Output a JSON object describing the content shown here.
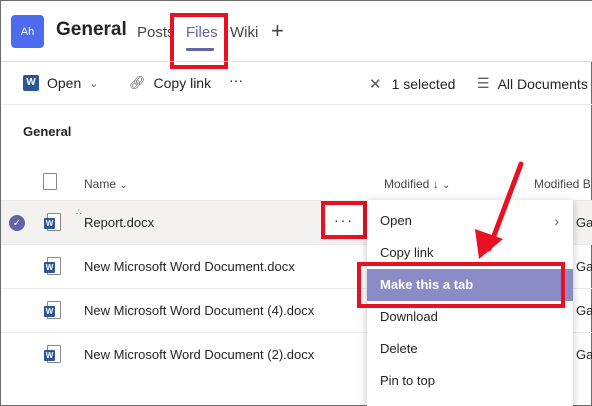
{
  "header": {
    "avatar": "Ah",
    "team_title": "General",
    "tabs": [
      "Posts",
      "Files",
      "Wiki"
    ],
    "add_tab": "+"
  },
  "toolbar": {
    "open_label": "Open",
    "copy_link_label": "Copy link",
    "more_label": "···",
    "selected_label": "1 selected",
    "view_label": "All Documents"
  },
  "section_title": "General",
  "columns": {
    "name": "Name",
    "modified": "Modified",
    "modified_by": "Modified B"
  },
  "files": [
    {
      "name": "Report.docx",
      "selected": true,
      "trail": "Ga"
    },
    {
      "name": "New Microsoft Word Document.docx",
      "selected": false,
      "trail": "Ga"
    },
    {
      "name": "New Microsoft Word Document (4).docx",
      "selected": false,
      "trail": "Ga"
    },
    {
      "name": "New Microsoft Word Document (2).docx",
      "selected": false,
      "trail": "Ga"
    }
  ],
  "row_more_label": "···",
  "context_menu": {
    "items": [
      "Open",
      "Copy link",
      "Make this a tab",
      "Download",
      "Delete",
      "Pin to top"
    ],
    "active_item": "Make this a tab"
  },
  "colors": {
    "accent": "#6264a7",
    "highlight_red": "#e81123",
    "menu_active_bg": "#8b8cc7",
    "word_blue": "#2b579a"
  }
}
